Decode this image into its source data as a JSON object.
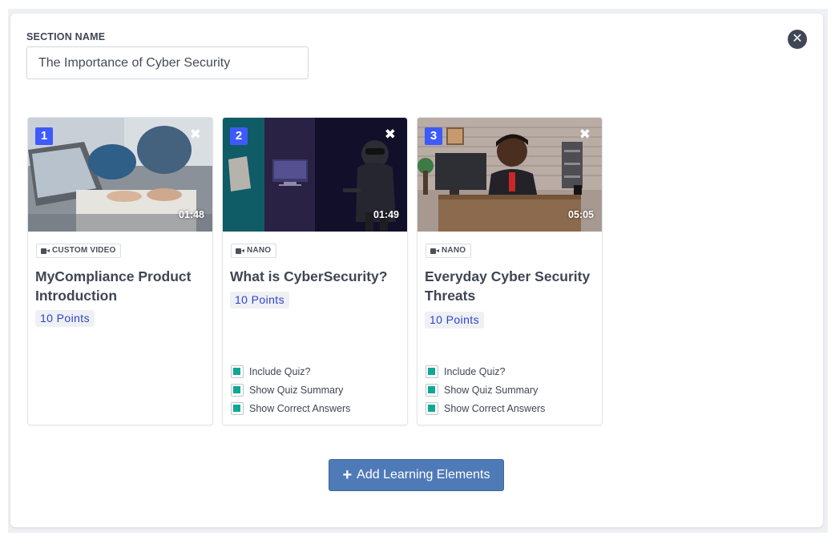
{
  "section": {
    "label": "SECTION NAME",
    "value": "The Importance of Cyber Security",
    "close_icon": "circle-x-icon"
  },
  "cards": [
    {
      "number": "1",
      "duration": "01:48",
      "type": "CUSTOM VIDEO",
      "title": "MyCompliance Product Introduction",
      "points": "10 Points",
      "options": []
    },
    {
      "number": "2",
      "duration": "01:49",
      "type": "NANO",
      "title": "What is CyberSecurity?",
      "points": "10 Points",
      "options": [
        "Include Quiz?",
        "Show Quiz Summary",
        "Show Correct Answers"
      ]
    },
    {
      "number": "3",
      "duration": "05:05",
      "type": "NANO",
      "title": "Everyday Cyber Security Threats",
      "points": "10 Points",
      "options": [
        "Include Quiz?",
        "Show Quiz Summary",
        "Show Correct Answers"
      ]
    }
  ],
  "add_button": {
    "label": "Add Learning Elements",
    "icon": "plus-icon"
  },
  "colors": {
    "accent": "#4f7ab8",
    "badge": "#3d5afe",
    "checkbox": "#0fa894",
    "points_text": "#2b45c9"
  }
}
